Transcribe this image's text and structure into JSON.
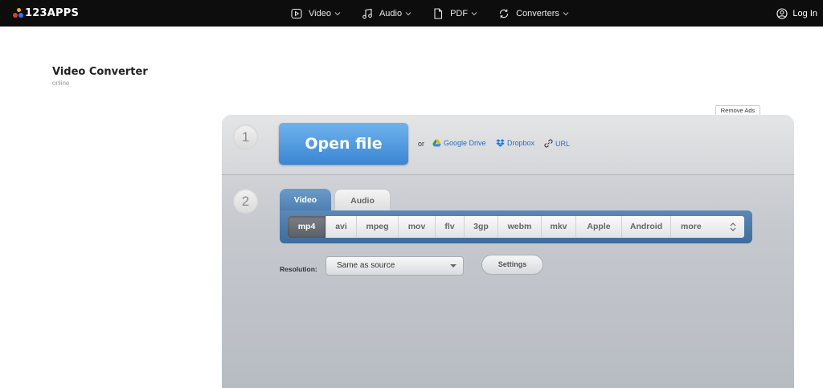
{
  "brand": {
    "name": "123APPS"
  },
  "nav": {
    "items": [
      {
        "label": "Video",
        "icon": "video-icon"
      },
      {
        "label": "Audio",
        "icon": "music-note-icon"
      },
      {
        "label": "PDF",
        "icon": "document-icon"
      },
      {
        "label": "Converters",
        "icon": "convert-arrows-icon"
      }
    ],
    "login_label": "Log In"
  },
  "page": {
    "title": "Video Converter",
    "subtitle": "online",
    "remove_ads": "Remove Ads"
  },
  "step1": {
    "number": "1",
    "open_file_label": "Open file",
    "or_text": "or",
    "sources": [
      {
        "label": "Google Drive",
        "icon": "google-drive-icon"
      },
      {
        "label": "Dropbox",
        "icon": "dropbox-icon"
      },
      {
        "label": "URL",
        "icon": "link-icon"
      }
    ]
  },
  "step2": {
    "number": "2",
    "tabs": [
      "Video",
      "Audio"
    ],
    "active_tab": "Video",
    "formats": [
      "mp4",
      "avi",
      "mpeg",
      "mov",
      "flv",
      "3gp",
      "webm",
      "mkv",
      "Apple",
      "Android",
      "more"
    ],
    "active_format": "mp4",
    "resolution_label": "Resolution:",
    "resolution_value": "Same as source",
    "settings_label": "Settings"
  },
  "colors": {
    "topbar_bg": "#0d0d0d",
    "open_file_blue": "#4a93dd",
    "link_blue": "#2a6cc0",
    "format_strip_blue": "#4d7fb0"
  }
}
